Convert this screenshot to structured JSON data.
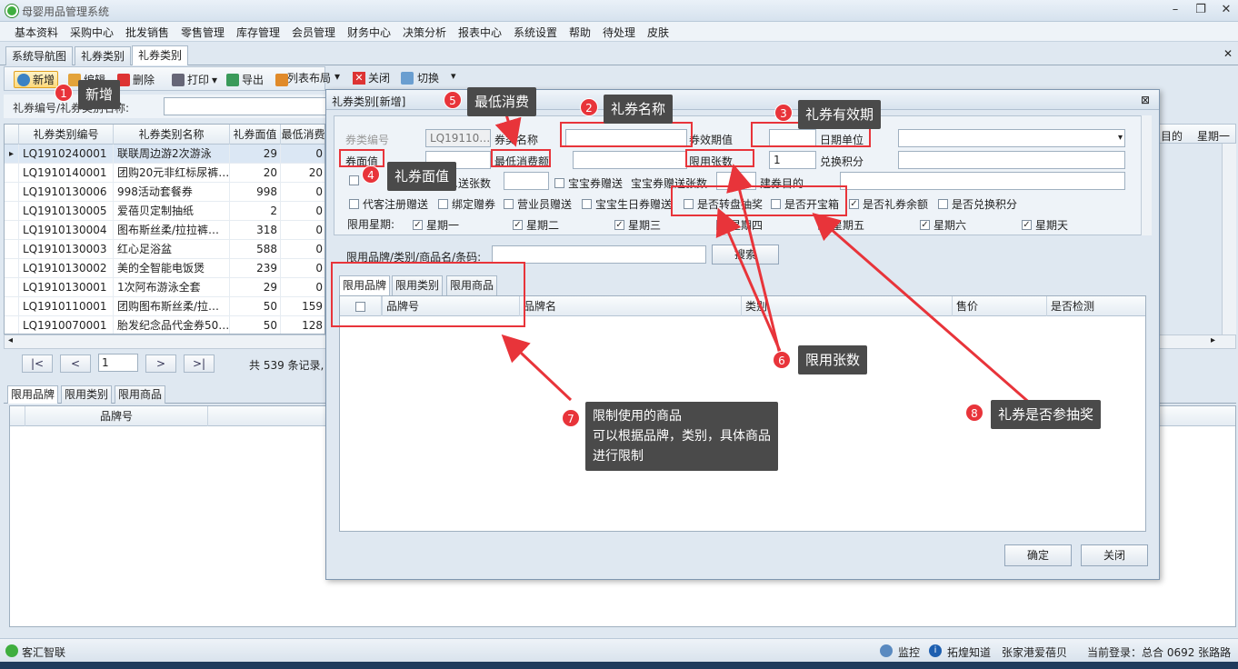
{
  "app": {
    "title": "母婴用品管理系统"
  },
  "menu": [
    "基本资料",
    "采购中心",
    "批发销售",
    "零售管理",
    "库存管理",
    "会员管理",
    "财务中心",
    "决策分析",
    "报表中心",
    "系统设置",
    "帮助",
    "待处理",
    "皮肤"
  ],
  "tabs": [
    "系统导航图",
    "礼券类别",
    "礼券类别"
  ],
  "toolbar": {
    "add": "新增",
    "edit": "编辑",
    "delete": "删除",
    "print": "打印",
    "export": "导出",
    "layout": "列表布局",
    "close": "关闭",
    "switch": "切换"
  },
  "search": {
    "label": "礼券编号/礼券类别名称:"
  },
  "grid": {
    "headers": [
      "礼券类别编号",
      "礼券类别名称",
      "礼券面值",
      "最低消费"
    ],
    "rows": [
      [
        "LQ1910240001",
        "联联周边游2次游泳",
        "29",
        "0"
      ],
      [
        "LQ1910140001",
        "团购20元非红标尿裤…",
        "20",
        "20"
      ],
      [
        "LQ1910130006",
        "998活动套餐券",
        "998",
        "0"
      ],
      [
        "LQ1910130005",
        "爱蓓贝定制抽纸",
        "2",
        "0"
      ],
      [
        "LQ1910130004",
        "图布斯丝柔/拉拉裤…",
        "318",
        "0"
      ],
      [
        "LQ1910130003",
        "红心足浴盆",
        "588",
        "0"
      ],
      [
        "LQ1910130002",
        "美的全智能电饭煲",
        "239",
        "0"
      ],
      [
        "LQ1910130001",
        "1次阿布游泳全套",
        "29",
        "0"
      ],
      [
        "LQ1910110001",
        "团购图布斯丝柔/拉…",
        "50",
        "159"
      ],
      [
        "LQ1910070001",
        "胎发纪念品代金券50…",
        "50",
        "128"
      ]
    ],
    "right_headers": [
      "目的",
      "星期一"
    ]
  },
  "pager": {
    "first": "|<",
    "prev": "<",
    "page": "1",
    "next": ">",
    "last": ">|",
    "summary": "共 539 条记录,"
  },
  "bottom_tabs": [
    "限用品牌",
    "限用类别",
    "限用商品"
  ],
  "bottom_grid": {
    "header": "品牌号"
  },
  "dialog": {
    "title": "礼券类别[新增]",
    "close": "⊠",
    "fields": {
      "code_label": "券类编号",
      "code_value": "LQ19110…",
      "name_label": "券类名称",
      "valid_label": "券效期值",
      "date_unit_label": "日期单位",
      "face_label": "券面值",
      "min_label": "最低消费额",
      "limit_label": "限用张数",
      "limit_value": "1",
      "points_label": "兑换积分",
      "give_label": "…送张数",
      "bb_give": "宝宝券赠送",
      "bb_give_count": "宝宝券赠送张数",
      "purpose_label": "建券目的",
      "reg_give": "代客注册赠送",
      "bind_give": "绑定赠券",
      "staff_give": "营业员赠送",
      "bday_give": "宝宝生日券赠送",
      "lottery": "是否转盘抽奖",
      "treasure": "是否开宝箱",
      "balance": "是否礼券余额",
      "exchange": "是否兑换积分",
      "weekday_label": "限用星期:",
      "weekdays": [
        "星期一",
        "星期二",
        "星期三",
        "星期四",
        "星期五",
        "星期六",
        "星期天"
      ]
    },
    "filter_label": "限用品牌/类别/商品名/条码:",
    "search_btn": "搜索",
    "tabs": [
      "限用品牌",
      "限用类别",
      "限用商品"
    ],
    "grid_headers": [
      "品牌号",
      "品牌名",
      "类别",
      "售价",
      "是否检测"
    ],
    "ok": "确定",
    "cancel": "关闭"
  },
  "status": {
    "left": "客汇智联",
    "monitor": "监控",
    "info": "拓煌知道",
    "store": "张家港爱蓓贝",
    "login": "当前登录：总合 0692 张路路"
  },
  "annotations": [
    {
      "num": "1",
      "text": "新增"
    },
    {
      "num": "2",
      "text": "礼券名称"
    },
    {
      "num": "3",
      "text": "礼券有效期"
    },
    {
      "num": "4",
      "text": "礼券面值"
    },
    {
      "num": "5",
      "text": "最低消费"
    },
    {
      "num": "6",
      "text": "限用张数"
    },
    {
      "num": "7",
      "line1": "限制使用的商品",
      "line2": "可以根据品牌，类别，具体商品",
      "line3": "进行限制"
    },
    {
      "num": "8",
      "text": "礼券是否参抽奖"
    }
  ]
}
